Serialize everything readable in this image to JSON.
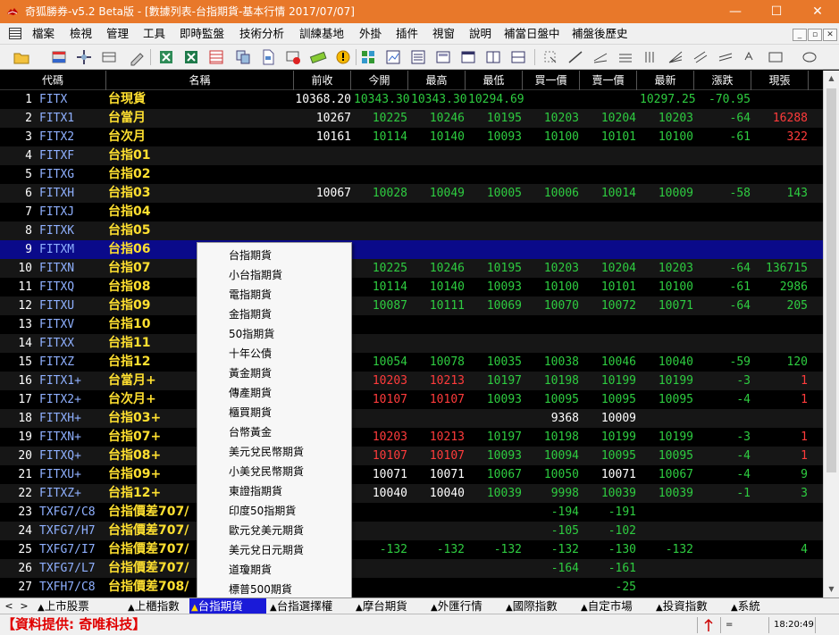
{
  "window": {
    "title": "奇狐勝券-v5.2 Beta版 - [數據列表-台指期貨-基本行情 2017/07/07]",
    "minimize": "—",
    "maximize": "☐",
    "close": "✕"
  },
  "menu": {
    "items": [
      "檔案",
      "檢視",
      "管理",
      "工具",
      "即時監盤",
      "技術分析",
      "訓練基地",
      "外掛",
      "插件",
      "視窗",
      "說明",
      "補當日盤中",
      "補盤後歷史"
    ],
    "mdi_buttons": [
      "_",
      "▫",
      "✕"
    ]
  },
  "grid": {
    "headers": [
      "代碼",
      "名稱",
      "前收",
      "今開",
      "最高",
      "最低",
      "買一價",
      "賣一價",
      "最新",
      "漲跌",
      "現張"
    ],
    "rows": [
      {
        "i": "1",
        "code": "FITX",
        "name": "台現貨",
        "prev": "10368.20",
        "open": "10343.30",
        "high": "10343.30",
        "low": "10294.69",
        "bid": "",
        "ask": "",
        "last": "10297.25",
        "chg": "-70.95",
        "vol": "",
        "cls": {
          "open": "g",
          "high": "g",
          "low": "g",
          "last": "g",
          "chg": "g"
        }
      },
      {
        "i": "2",
        "code": "FITX1",
        "name": "台當月",
        "prev": "10267",
        "open": "10225",
        "high": "10246",
        "low": "10195",
        "bid": "10203",
        "ask": "10204",
        "last": "10203",
        "chg": "-64",
        "vol": "16288",
        "cls": {
          "open": "g",
          "high": "g",
          "low": "g",
          "bid": "g",
          "ask": "g",
          "last": "g",
          "chg": "g",
          "vol": "r"
        }
      },
      {
        "i": "3",
        "code": "FITX2",
        "name": "台次月",
        "prev": "10161",
        "open": "10114",
        "high": "10140",
        "low": "10093",
        "bid": "10100",
        "ask": "10101",
        "last": "10100",
        "chg": "-61",
        "vol": "322",
        "cls": {
          "open": "g",
          "high": "g",
          "low": "g",
          "bid": "g",
          "ask": "g",
          "last": "g",
          "chg": "g",
          "vol": "r"
        }
      },
      {
        "i": "4",
        "code": "FITXF",
        "name": "台指01",
        "prev": "",
        "open": "",
        "high": "",
        "low": "",
        "bid": "",
        "ask": "",
        "last": "",
        "chg": "",
        "vol": "",
        "cls": {}
      },
      {
        "i": "5",
        "code": "FITXG",
        "name": "台指02",
        "prev": "",
        "open": "",
        "high": "",
        "low": "",
        "bid": "",
        "ask": "",
        "last": "",
        "chg": "",
        "vol": "",
        "cls": {}
      },
      {
        "i": "6",
        "code": "FITXH",
        "name": "台指03",
        "prev": "10067",
        "open": "10028",
        "high": "10049",
        "low": "10005",
        "bid": "10006",
        "ask": "10014",
        "last": "10009",
        "chg": "-58",
        "vol": "143",
        "cls": {
          "open": "g",
          "high": "g",
          "low": "g",
          "bid": "g",
          "ask": "g",
          "last": "g",
          "chg": "g",
          "vol": "g"
        }
      },
      {
        "i": "7",
        "code": "FITXJ",
        "name": "台指04",
        "prev": "",
        "open": "",
        "high": "",
        "low": "",
        "bid": "",
        "ask": "",
        "last": "",
        "chg": "",
        "vol": "",
        "cls": {}
      },
      {
        "i": "8",
        "code": "FITXK",
        "name": "台指05",
        "prev": "",
        "open": "",
        "high": "",
        "low": "",
        "bid": "",
        "ask": "",
        "last": "",
        "chg": "",
        "vol": "",
        "cls": {}
      },
      {
        "i": "9",
        "code": "FITXM",
        "name": "台指06",
        "prev": "",
        "open": "",
        "high": "",
        "low": "",
        "bid": "",
        "ask": "",
        "last": "",
        "chg": "",
        "vol": "",
        "cls": {},
        "selected": true
      },
      {
        "i": "10",
        "code": "FITXN",
        "name": "台指07",
        "prev": "",
        "open": "10225",
        "high": "10246",
        "low": "10195",
        "bid": "10203",
        "ask": "10204",
        "last": "10203",
        "chg": "-64",
        "vol": "136715",
        "cls": {
          "open": "g",
          "high": "g",
          "low": "g",
          "bid": "g",
          "ask": "g",
          "last": "g",
          "chg": "g",
          "vol": "g"
        }
      },
      {
        "i": "11",
        "code": "FITXQ",
        "name": "台指08",
        "prev": "",
        "open": "10114",
        "high": "10140",
        "low": "10093",
        "bid": "10100",
        "ask": "10101",
        "last": "10100",
        "chg": "-61",
        "vol": "2986",
        "cls": {
          "open": "g",
          "high": "g",
          "low": "g",
          "bid": "g",
          "ask": "g",
          "last": "g",
          "chg": "g",
          "vol": "g"
        }
      },
      {
        "i": "12",
        "code": "FITXU",
        "name": "台指09",
        "prev": "",
        "open": "10087",
        "high": "10111",
        "low": "10069",
        "bid": "10070",
        "ask": "10072",
        "last": "10071",
        "chg": "-64",
        "vol": "205",
        "cls": {
          "open": "g",
          "high": "g",
          "low": "g",
          "bid": "g",
          "ask": "g",
          "last": "g",
          "chg": "g",
          "vol": "g"
        }
      },
      {
        "i": "13",
        "code": "FITXV",
        "name": "台指10",
        "prev": "",
        "open": "",
        "high": "",
        "low": "",
        "bid": "",
        "ask": "",
        "last": "",
        "chg": "",
        "vol": "",
        "cls": {}
      },
      {
        "i": "14",
        "code": "FITXX",
        "name": "台指11",
        "prev": "",
        "open": "",
        "high": "",
        "low": "",
        "bid": "",
        "ask": "",
        "last": "",
        "chg": "",
        "vol": "",
        "cls": {}
      },
      {
        "i": "15",
        "code": "FITXZ",
        "name": "台指12",
        "prev": "",
        "open": "10054",
        "high": "10078",
        "low": "10035",
        "bid": "10038",
        "ask": "10046",
        "last": "10040",
        "chg": "-59",
        "vol": "120",
        "cls": {
          "open": "g",
          "high": "g",
          "low": "g",
          "bid": "g",
          "ask": "g",
          "last": "g",
          "chg": "g",
          "vol": "g"
        }
      },
      {
        "i": "16",
        "code": "FITX1+",
        "name": "台當月+",
        "prev": "",
        "open": "10203",
        "high": "10213",
        "low": "10197",
        "bid": "10198",
        "ask": "10199",
        "last": "10199",
        "chg": "-3",
        "vol": "1",
        "cls": {
          "open": "r",
          "high": "r",
          "low": "g",
          "bid": "g",
          "ask": "g",
          "last": "g",
          "chg": "g",
          "vol": "r"
        }
      },
      {
        "i": "17",
        "code": "FITX2+",
        "name": "台次月+",
        "prev": "",
        "open": "10107",
        "high": "10107",
        "low": "10093",
        "bid": "10095",
        "ask": "10095",
        "last": "10095",
        "chg": "-4",
        "vol": "1",
        "cls": {
          "open": "r",
          "high": "r",
          "low": "g",
          "bid": "g",
          "ask": "g",
          "last": "g",
          "chg": "g",
          "vol": "r"
        }
      },
      {
        "i": "18",
        "code": "FITXH+",
        "name": "台指03+",
        "prev": "",
        "open": "",
        "high": "",
        "low": "",
        "bid": "9368",
        "ask": "10009",
        "last": "",
        "chg": "",
        "vol": "",
        "cls": {
          "bid": "w",
          "ask": "w"
        }
      },
      {
        "i": "19",
        "code": "FITXN+",
        "name": "台指07+",
        "prev": "",
        "open": "10203",
        "high": "10213",
        "low": "10197",
        "bid": "10198",
        "ask": "10199",
        "last": "10199",
        "chg": "-3",
        "vol": "1",
        "cls": {
          "open": "r",
          "high": "r",
          "low": "g",
          "bid": "g",
          "ask": "g",
          "last": "g",
          "chg": "g",
          "vol": "r"
        }
      },
      {
        "i": "20",
        "code": "FITXQ+",
        "name": "台指08+",
        "prev": "",
        "open": "10107",
        "high": "10107",
        "low": "10093",
        "bid": "10094",
        "ask": "10095",
        "last": "10095",
        "chg": "-4",
        "vol": "1",
        "cls": {
          "open": "r",
          "high": "r",
          "low": "g",
          "bid": "g",
          "ask": "g",
          "last": "g",
          "chg": "g",
          "vol": "r"
        }
      },
      {
        "i": "21",
        "code": "FITXU+",
        "name": "台指09+",
        "prev": "",
        "open": "10071",
        "high": "10071",
        "low": "10067",
        "bid": "10050",
        "ask": "10071",
        "last": "10067",
        "chg": "-4",
        "vol": "9",
        "cls": {
          "open": "w",
          "high": "w",
          "low": "g",
          "bid": "g",
          "ask": "w",
          "last": "g",
          "chg": "g",
          "vol": "g"
        }
      },
      {
        "i": "22",
        "code": "FITXZ+",
        "name": "台指12+",
        "prev": "",
        "open": "10040",
        "high": "10040",
        "low": "10039",
        "bid": "9998",
        "ask": "10039",
        "last": "10039",
        "chg": "-1",
        "vol": "3",
        "cls": {
          "open": "w",
          "high": "w",
          "low": "g",
          "bid": "g",
          "ask": "g",
          "last": "g",
          "chg": "g",
          "vol": "g"
        }
      },
      {
        "i": "23",
        "code": "TXFG7/C8",
        "name": "台指價差707/",
        "prev": "",
        "open": "",
        "high": "",
        "low": "",
        "bid": "-194",
        "ask": "-191",
        "last": "",
        "chg": "",
        "vol": "",
        "cls": {
          "bid": "g",
          "ask": "g"
        }
      },
      {
        "i": "24",
        "code": "TXFG7/H7",
        "name": "台指價差707/",
        "prev": "",
        "open": "",
        "high": "",
        "low": "",
        "bid": "-105",
        "ask": "-102",
        "last": "",
        "chg": "",
        "vol": "",
        "cls": {
          "bid": "g",
          "ask": "g"
        }
      },
      {
        "i": "25",
        "code": "TXFG7/I7",
        "name": "台指價差707/",
        "prev": "",
        "open": "-132",
        "high": "-132",
        "low": "-132",
        "bid": "-132",
        "ask": "-130",
        "last": "-132",
        "chg": "",
        "vol": "4",
        "cls": {
          "open": "g",
          "high": "g",
          "low": "g",
          "bid": "g",
          "ask": "g",
          "last": "g",
          "vol": "g"
        }
      },
      {
        "i": "26",
        "code": "TXFG7/L7",
        "name": "台指價差707/",
        "prev": "",
        "open": "",
        "high": "",
        "low": "",
        "bid": "-164",
        "ask": "-161",
        "last": "",
        "chg": "",
        "vol": "",
        "cls": {
          "bid": "g",
          "ask": "g"
        }
      },
      {
        "i": "27",
        "code": "TXFH7/C8",
        "name": "台指價差708/",
        "prev": "",
        "open": "",
        "high": "",
        "low": "",
        "bid": "",
        "ask": "-25",
        "last": "",
        "chg": "",
        "vol": "",
        "cls": {
          "ask": "g"
        }
      }
    ]
  },
  "dropdown": {
    "options": [
      "台指期貨",
      "小台指期貨",
      "電指期貨",
      "金指期貨",
      "50指期貨",
      "十年公債",
      "黃金期貨",
      "傳產期貨",
      "櫃買期貨",
      "台幣黃金",
      "美元兌民幣期貨",
      "小美兌民幣期貨",
      "東證指期貨",
      "印度50指期貨",
      "歐元兌美元期貨",
      "美元兌日元期貨",
      "道瓊期貨",
      "標普500期貨"
    ]
  },
  "tabs": {
    "nav_prev": "<",
    "nav_next": ">",
    "items": [
      "上市股票",
      "上櫃指數",
      "台指期貨",
      "台指選擇權",
      "摩台期貨",
      "外匯行情",
      "國際指數",
      "自定市場",
      "投資指數",
      "系統"
    ]
  },
  "status": {
    "provider": "【資料提供: 奇唯科技】",
    "eq": "=",
    "clock": "18:20:49"
  },
  "colors": {
    "title_bar": "#e8782a",
    "up": "#ff3b3b",
    "down": "#2ecc40",
    "name": "#ffe030",
    "code": "#8fb0ff",
    "selected_row": "#0a0a8a"
  }
}
